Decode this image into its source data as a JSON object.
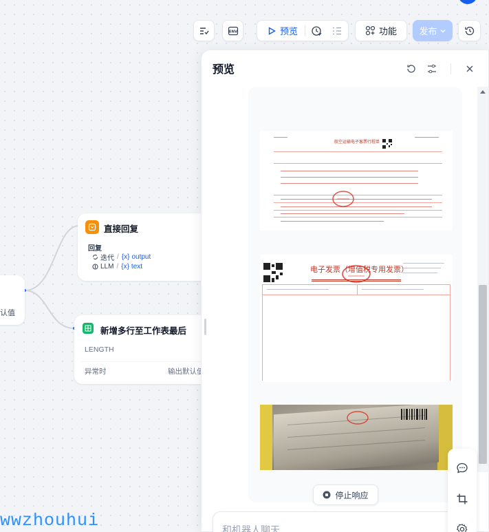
{
  "toolbar": {
    "preview_label": "预览",
    "features_label": "功能",
    "publish_label": "发布",
    "env_icon": "env-icon"
  },
  "canvas": {
    "node_reply": {
      "title": "直接回复",
      "section_label": "回复",
      "line1_source": "迭代",
      "line1_var": "output",
      "line2_source": "LLM",
      "line2_var": "text",
      "var_symbol": "{x}"
    },
    "node_sheet": {
      "title": "新增多行至工作表最后",
      "field_length": "LENGTH",
      "exception_label": "异常时",
      "exception_value": "输出默认值"
    },
    "left_partial_text": "认值"
  },
  "panel": {
    "title": "预览",
    "stop_label": "停止响应",
    "chat_placeholder": "和机器人聊天"
  },
  "invoice_flight": {
    "title": "航空运输电子客票行程单"
  },
  "invoice_vat": {
    "title": "电子发票（增值税专用发票）"
  },
  "watermark": "wwzhouhui",
  "colors": {
    "accent": "#155eef",
    "publish_bg": "#b2ccff",
    "reply_icon": "#f79009",
    "sheet_icon": "#12b76a",
    "stamp_red": "#d92d20"
  }
}
